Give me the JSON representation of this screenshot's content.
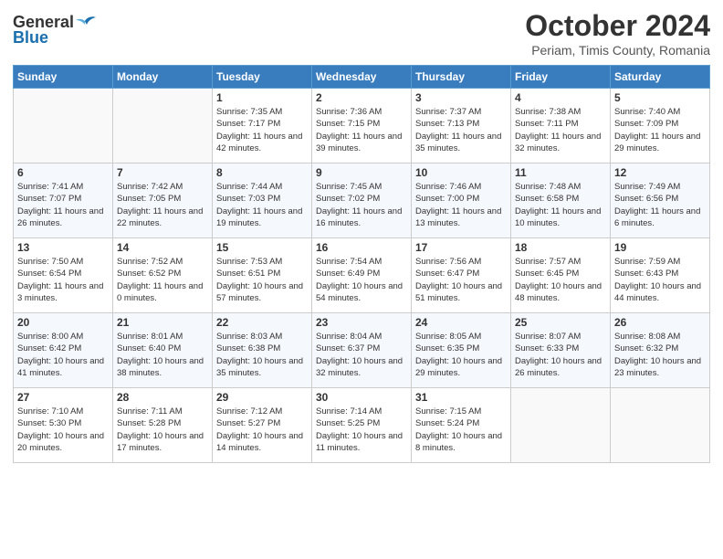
{
  "header": {
    "logo_general": "General",
    "logo_blue": "Blue",
    "title": "October 2024",
    "subtitle": "Periam, Timis County, Romania"
  },
  "days_of_week": [
    "Sunday",
    "Monday",
    "Tuesday",
    "Wednesday",
    "Thursday",
    "Friday",
    "Saturday"
  ],
  "weeks": [
    [
      {
        "day": "",
        "info": ""
      },
      {
        "day": "",
        "info": ""
      },
      {
        "day": "1",
        "info": "Sunrise: 7:35 AM\nSunset: 7:17 PM\nDaylight: 11 hours and 42 minutes."
      },
      {
        "day": "2",
        "info": "Sunrise: 7:36 AM\nSunset: 7:15 PM\nDaylight: 11 hours and 39 minutes."
      },
      {
        "day": "3",
        "info": "Sunrise: 7:37 AM\nSunset: 7:13 PM\nDaylight: 11 hours and 35 minutes."
      },
      {
        "day": "4",
        "info": "Sunrise: 7:38 AM\nSunset: 7:11 PM\nDaylight: 11 hours and 32 minutes."
      },
      {
        "day": "5",
        "info": "Sunrise: 7:40 AM\nSunset: 7:09 PM\nDaylight: 11 hours and 29 minutes."
      }
    ],
    [
      {
        "day": "6",
        "info": "Sunrise: 7:41 AM\nSunset: 7:07 PM\nDaylight: 11 hours and 26 minutes."
      },
      {
        "day": "7",
        "info": "Sunrise: 7:42 AM\nSunset: 7:05 PM\nDaylight: 11 hours and 22 minutes."
      },
      {
        "day": "8",
        "info": "Sunrise: 7:44 AM\nSunset: 7:03 PM\nDaylight: 11 hours and 19 minutes."
      },
      {
        "day": "9",
        "info": "Sunrise: 7:45 AM\nSunset: 7:02 PM\nDaylight: 11 hours and 16 minutes."
      },
      {
        "day": "10",
        "info": "Sunrise: 7:46 AM\nSunset: 7:00 PM\nDaylight: 11 hours and 13 minutes."
      },
      {
        "day": "11",
        "info": "Sunrise: 7:48 AM\nSunset: 6:58 PM\nDaylight: 11 hours and 10 minutes."
      },
      {
        "day": "12",
        "info": "Sunrise: 7:49 AM\nSunset: 6:56 PM\nDaylight: 11 hours and 6 minutes."
      }
    ],
    [
      {
        "day": "13",
        "info": "Sunrise: 7:50 AM\nSunset: 6:54 PM\nDaylight: 11 hours and 3 minutes."
      },
      {
        "day": "14",
        "info": "Sunrise: 7:52 AM\nSunset: 6:52 PM\nDaylight: 11 hours and 0 minutes."
      },
      {
        "day": "15",
        "info": "Sunrise: 7:53 AM\nSunset: 6:51 PM\nDaylight: 10 hours and 57 minutes."
      },
      {
        "day": "16",
        "info": "Sunrise: 7:54 AM\nSunset: 6:49 PM\nDaylight: 10 hours and 54 minutes."
      },
      {
        "day": "17",
        "info": "Sunrise: 7:56 AM\nSunset: 6:47 PM\nDaylight: 10 hours and 51 minutes."
      },
      {
        "day": "18",
        "info": "Sunrise: 7:57 AM\nSunset: 6:45 PM\nDaylight: 10 hours and 48 minutes."
      },
      {
        "day": "19",
        "info": "Sunrise: 7:59 AM\nSunset: 6:43 PM\nDaylight: 10 hours and 44 minutes."
      }
    ],
    [
      {
        "day": "20",
        "info": "Sunrise: 8:00 AM\nSunset: 6:42 PM\nDaylight: 10 hours and 41 minutes."
      },
      {
        "day": "21",
        "info": "Sunrise: 8:01 AM\nSunset: 6:40 PM\nDaylight: 10 hours and 38 minutes."
      },
      {
        "day": "22",
        "info": "Sunrise: 8:03 AM\nSunset: 6:38 PM\nDaylight: 10 hours and 35 minutes."
      },
      {
        "day": "23",
        "info": "Sunrise: 8:04 AM\nSunset: 6:37 PM\nDaylight: 10 hours and 32 minutes."
      },
      {
        "day": "24",
        "info": "Sunrise: 8:05 AM\nSunset: 6:35 PM\nDaylight: 10 hours and 29 minutes."
      },
      {
        "day": "25",
        "info": "Sunrise: 8:07 AM\nSunset: 6:33 PM\nDaylight: 10 hours and 26 minutes."
      },
      {
        "day": "26",
        "info": "Sunrise: 8:08 AM\nSunset: 6:32 PM\nDaylight: 10 hours and 23 minutes."
      }
    ],
    [
      {
        "day": "27",
        "info": "Sunrise: 7:10 AM\nSunset: 5:30 PM\nDaylight: 10 hours and 20 minutes."
      },
      {
        "day": "28",
        "info": "Sunrise: 7:11 AM\nSunset: 5:28 PM\nDaylight: 10 hours and 17 minutes."
      },
      {
        "day": "29",
        "info": "Sunrise: 7:12 AM\nSunset: 5:27 PM\nDaylight: 10 hours and 14 minutes."
      },
      {
        "day": "30",
        "info": "Sunrise: 7:14 AM\nSunset: 5:25 PM\nDaylight: 10 hours and 11 minutes."
      },
      {
        "day": "31",
        "info": "Sunrise: 7:15 AM\nSunset: 5:24 PM\nDaylight: 10 hours and 8 minutes."
      },
      {
        "day": "",
        "info": ""
      },
      {
        "day": "",
        "info": ""
      }
    ]
  ]
}
